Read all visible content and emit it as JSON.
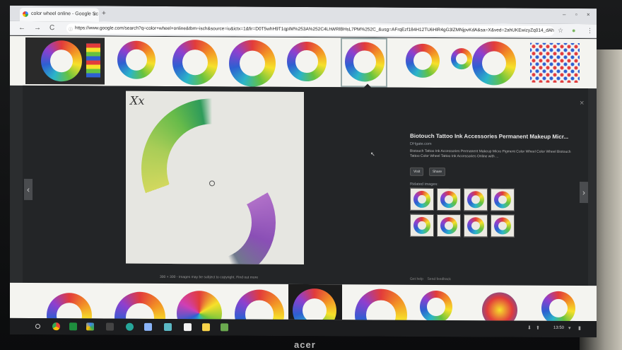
{
  "browser": {
    "tab_title": "color wheel online - Google Sc",
    "tab_close": "×",
    "new_tab": "+",
    "window_controls": [
      "–",
      "▫",
      "×"
    ],
    "back": "←",
    "forward": "→",
    "reload": "C",
    "url": "https://www.google.com/search?q=color+wheel+online&tbm=isch&source=iu&ictx=1&fir=D0T5whH9T1qpIM%253A%252C4LhWRlBHsL7PM%252C_&usg=AFrqEzf184H12TU6HlR4gG3lZMNjpvKdA&sa=X&ved=2ahUKEwizyZq014_dAhU...",
    "star": "☆",
    "menu": "⋮"
  },
  "viewer": {
    "close": "×",
    "prev": "‹",
    "next": "›",
    "image_logo": "Xx",
    "caption": "300 × 300 - Images may be subject to copyright. Find out more",
    "title": "Biotouch Tattoo Ink Accessories Permanent Makeup Micr...",
    "site": "DHgate.com",
    "description": "Biotouch Tattoo Ink Accessories Permanent Makeup Micro Pigment Color Wheel Color Wheel Biotouch Tattoo Color Wheel Tattoo Ink Accessories Online with ...",
    "visit_label": "Visit",
    "share_label": "Share",
    "related_label": "Related images:",
    "footer_help": "Get help",
    "footer_feedback": "Send feedback"
  },
  "shelf": {
    "clock": "13:50",
    "tray_icons": [
      "⬇",
      "⬆",
      "▾",
      "▮"
    ]
  },
  "monitor": {
    "brand": "acer"
  },
  "colors": {
    "panel_bg": "#232527",
    "strip_bg": "#f4f4f0",
    "tab_bg": "#f7f8f9",
    "shelf_bg": "#1c1d1f"
  }
}
